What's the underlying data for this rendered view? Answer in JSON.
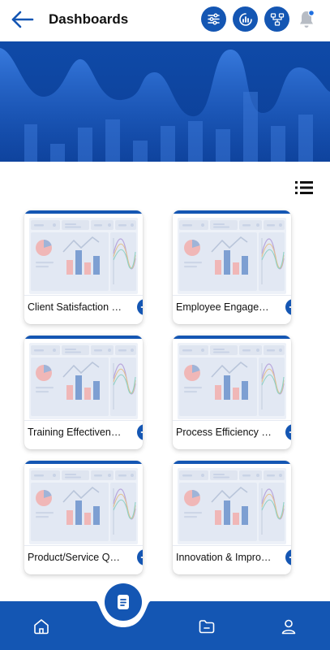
{
  "header": {
    "title": "Dashboards"
  },
  "cards": [
    {
      "label": "Client Satisfaction Dashboard"
    },
    {
      "label": "Employee Engagement Dashboard"
    },
    {
      "label": "Training Effectiveness Dashboard"
    },
    {
      "label": "Process Efficiency Dashboard"
    },
    {
      "label": "Product/Service Quality Dashboard"
    },
    {
      "label": "Innovation & Improvement Dashboard"
    }
  ],
  "colors": {
    "primary": "#1456b3",
    "banner_light": "#2b6fd6",
    "thumb_bg": "#edf1f8",
    "notify_dot": "#1f6fe0"
  },
  "icons": {
    "back": "arrow-left-icon",
    "filter": "sliders-icon",
    "report": "chart-report-icon",
    "hierarchy": "org-chart-icon",
    "notifications": "bell-icon",
    "list_view": "list-icon",
    "card_open": "arrow-right-circle-icon",
    "nav_home": "home-icon",
    "nav_dashboards": "document-icon",
    "nav_folder": "folder-icon",
    "nav_profile": "user-icon"
  }
}
